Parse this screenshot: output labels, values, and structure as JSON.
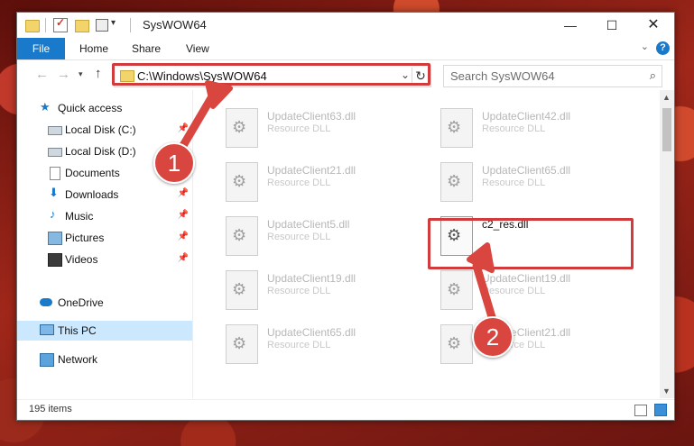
{
  "window": {
    "title": "SysWOW64",
    "controls": {
      "minimize": "—",
      "maximize": "☐",
      "close": "✕"
    }
  },
  "ribbon": {
    "tabs": [
      "File",
      "Home",
      "Share",
      "View"
    ],
    "help": "?"
  },
  "address": {
    "path": "C:\\Windows\\SysWOW64",
    "search_placeholder": "Search SysWOW64"
  },
  "nav": {
    "items": [
      {
        "label": "Quick access",
        "icon": "star-icon"
      },
      {
        "label": "Local Disk (C:)",
        "icon": "disk-icon"
      },
      {
        "label": "Local Disk (D:)",
        "icon": "disk-icon"
      },
      {
        "label": "Documents",
        "icon": "documents-icon"
      },
      {
        "label": "Downloads",
        "icon": "download-icon"
      },
      {
        "label": "Music",
        "icon": "music-icon"
      },
      {
        "label": "Pictures",
        "icon": "pictures-icon"
      },
      {
        "label": "Videos",
        "icon": "videos-icon"
      },
      {
        "label": "OneDrive",
        "icon": "cloud-icon"
      },
      {
        "label": "This PC",
        "icon": "computer-icon",
        "selected": true
      },
      {
        "label": "Network",
        "icon": "network-icon"
      }
    ]
  },
  "files": {
    "left": [
      {
        "name": "UpdateClient63.dll",
        "desc": "Resource DLL"
      },
      {
        "name": "UpdateClient21.dll",
        "desc": "Resource DLL"
      },
      {
        "name": "UpdateClient5.dll",
        "desc": "Resource DLL"
      },
      {
        "name": "UpdateClient19.dll",
        "desc": "Resource DLL"
      },
      {
        "name": "UpdateClient65.dll",
        "desc": "Resource DLL"
      }
    ],
    "right": [
      {
        "name": "UpdateClient42.dll",
        "desc": "Resource DLL"
      },
      {
        "name": "UpdateClient65.dll",
        "desc": "Resource DLL"
      },
      {
        "name": "c2_res.dll",
        "desc": ""
      },
      {
        "name": "UpdateClient19.dll",
        "desc": "Resource DLL"
      },
      {
        "name": "UpdateClient21.dll",
        "desc": "Resource DLL"
      }
    ]
  },
  "status": {
    "item_count": "195 items"
  },
  "callouts": {
    "one": "1",
    "two": "2"
  },
  "colors": {
    "highlight": "#d13b3b",
    "accent": "#1979ca",
    "callout": "#d9463f"
  }
}
